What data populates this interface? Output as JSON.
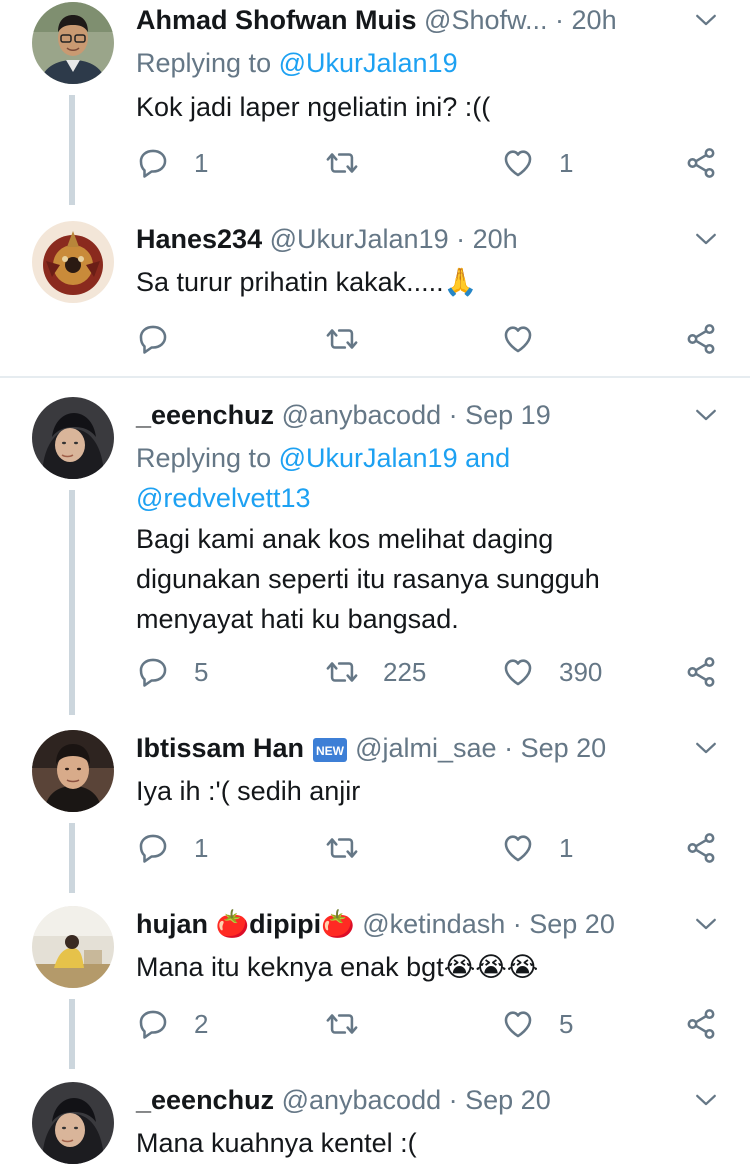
{
  "colors": {
    "link": "#1da1f2",
    "muted": "#657786",
    "text": "#14171a",
    "line": "#ccd6dd"
  },
  "tweets": [
    {
      "name": "Ahmad Shofwan Muis",
      "handle": "@Shofw...",
      "time": "20h",
      "replying_prefix": "Replying to ",
      "replying_to": "@UkurJalan19",
      "replying_to2": "",
      "text_lines": [
        "Kok jadi laper ngeliatin ini? :(("
      ],
      "reply_count": "1",
      "retweet_count": "",
      "like_count": "1",
      "avatar": "man-glasses-avatar"
    },
    {
      "name": "Hanes234",
      "handle": "@UkurJalan19",
      "time": "20h",
      "text_lines": [
        "Sa turur prihatin kakak.....🙏"
      ],
      "reply_count": "",
      "retweet_count": "",
      "like_count": "",
      "avatar": "ornament-avatar"
    },
    {
      "name": "_eeenchuz",
      "handle": "@anybacodd",
      "time": "Sep 19",
      "replying_prefix": "Replying to ",
      "replying_to": "@UkurJalan19 and",
      "replying_to2": "@redvelvett13",
      "text_lines": [
        "Bagi kami anak kos melihat daging",
        "digunakan seperti itu rasanya sungguh",
        "menyayat hati ku bangsad."
      ],
      "reply_count": "5",
      "retweet_count": "225",
      "like_count": "390",
      "avatar": "hijab-woman-avatar"
    },
    {
      "name": "Ibtissam Han",
      "badge": "NEW",
      "handle": "@jalmi_sae",
      "time": "Sep 20",
      "text_lines": [
        "Iya ih :'( sedih anjir"
      ],
      "reply_count": "1",
      "retweet_count": "",
      "like_count": "1",
      "avatar": "man-portrait-avatar"
    },
    {
      "name": "hujan 🍅dipipi🍅",
      "handle": "@ketindash",
      "time": "Sep 20",
      "text_lines": [
        "Mana itu keknya enak bgt😭😭😭"
      ],
      "reply_count": "2",
      "retweet_count": "",
      "like_count": "5",
      "avatar": "room-photo-avatar"
    },
    {
      "name": "_eeenchuz",
      "handle": "@anybacodd",
      "time": "Sep 20",
      "text_lines": [
        "Mana kuahnya kentel :("
      ],
      "avatar": "hijab-woman-avatar"
    }
  ],
  "separator": "·",
  "icons": {
    "reply": "reply-icon",
    "retweet": "retweet-icon",
    "like": "like-icon",
    "share": "share-icon",
    "more": "chevron-down-icon"
  }
}
